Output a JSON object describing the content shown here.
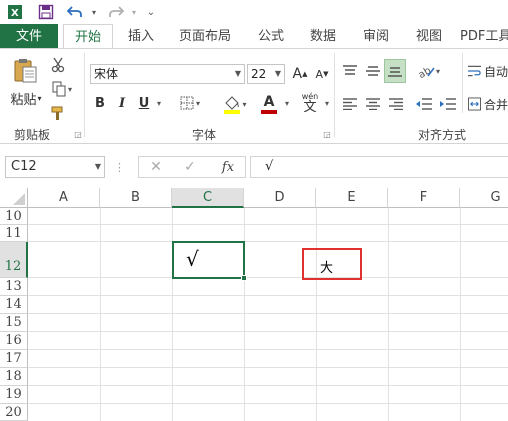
{
  "qat": {
    "app_icon": "excel-icon",
    "customize": "⌄"
  },
  "tabs": {
    "file": "文件",
    "home": "开始",
    "insert": "插入",
    "layout": "页面布局",
    "formulas": "公式",
    "data": "数据",
    "review": "审阅",
    "view": "视图",
    "pdf": "PDF工具"
  },
  "ribbon": {
    "paste_label": "粘贴",
    "clipboard_group": "剪贴板",
    "font_name": "宋体",
    "font_size": "22",
    "bold": "B",
    "italic": "I",
    "underline": "U",
    "font_color_letter": "A",
    "phonetic": "wén",
    "font_group": "字体",
    "wrap_text": "自动",
    "merge": "合并",
    "alignment_group": "对齐方式",
    "colors": {
      "fill": "#ffff00",
      "font": "#c00000",
      "accent": "#217346"
    }
  },
  "formula_bar": {
    "name_box": "C12",
    "fx": "fx",
    "content": "√"
  },
  "sheet": {
    "columns": [
      "A",
      "B",
      "C",
      "D",
      "E",
      "F",
      "G"
    ],
    "rows": [
      "10",
      "11",
      "12",
      "13",
      "14",
      "15",
      "16",
      "17",
      "18",
      "19",
      "20"
    ],
    "selected_cell": "C12",
    "cells": {
      "C12": "√",
      "E12": "大"
    },
    "highlight_color": "#e03030"
  }
}
